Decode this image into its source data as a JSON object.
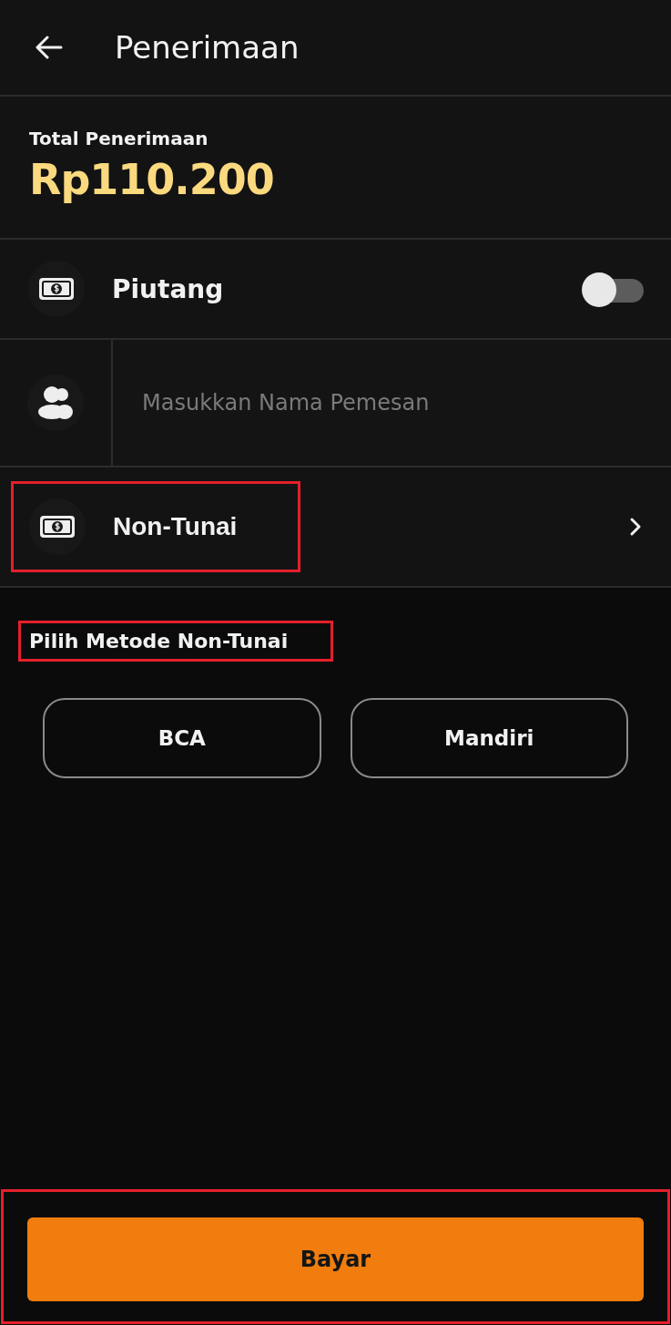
{
  "header": {
    "title": "Penerimaan"
  },
  "total": {
    "label": "Total Penerimaan",
    "amount": "Rp110.200"
  },
  "piutang": {
    "label": "Piutang",
    "on": false
  },
  "customer": {
    "placeholder": "Masukkan Nama Pemesan"
  },
  "payment": {
    "label": "Non-Tunai",
    "highlighted": true
  },
  "methods": {
    "title": "Pilih Metode Non-Tunai",
    "highlighted": true,
    "options": [
      {
        "label": "BCA",
        "selected": false
      },
      {
        "label": "Mandiri",
        "selected": false
      }
    ]
  },
  "footer": {
    "button": "Bayar",
    "highlighted": true
  }
}
